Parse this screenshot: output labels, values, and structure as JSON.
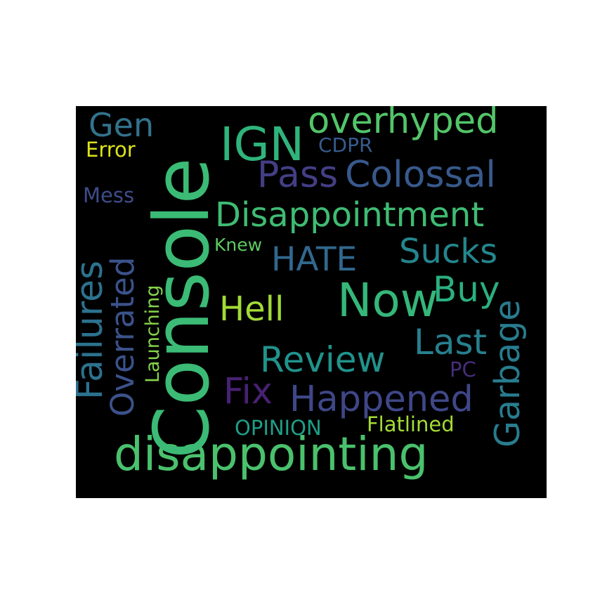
{
  "word_cloud": {
    "background": "#000000",
    "words": {
      "gen": {
        "text": "Gen",
        "color": "#33728c"
      },
      "error": {
        "text": "Error",
        "color": "#dde318"
      },
      "console": {
        "text": "Console",
        "color": "#3bbb75"
      },
      "ign": {
        "text": "IGN",
        "color": "#2fb47c"
      },
      "overhyped": {
        "text": "overhyped",
        "color": "#52c569"
      },
      "cdpr": {
        "text": "CDPR",
        "color": "#365c8d"
      },
      "pass": {
        "text": "Pass",
        "color": "#433e85"
      },
      "colossal": {
        "text": "Colossal",
        "color": "#38598c"
      },
      "mess": {
        "text": "Mess",
        "color": "#3e4c8a"
      },
      "disappointment": {
        "text": "Disappointment",
        "color": "#3fbc73"
      },
      "failures": {
        "text": "Failures",
        "color": "#2c728e"
      },
      "overrated": {
        "text": "Overrated",
        "color": "#3b528b"
      },
      "knew": {
        "text": "Knew",
        "color": "#5ec962"
      },
      "launching": {
        "text": "Launching",
        "color": "#84d44b"
      },
      "hate": {
        "text": "HATE",
        "color": "#31688e"
      },
      "sucks": {
        "text": "Sucks",
        "color": "#24868e"
      },
      "now": {
        "text": "Now",
        "color": "#35b779"
      },
      "buy": {
        "text": "Buy",
        "color": "#2ab07f"
      },
      "hell": {
        "text": "Hell",
        "color": "#a2da37"
      },
      "garbage": {
        "text": "Garbage",
        "color": "#287c8e"
      },
      "last": {
        "text": "Last",
        "color": "#277f8e"
      },
      "review": {
        "text": "Review",
        "color": "#20938c"
      },
      "pc": {
        "text": "PC",
        "color": "#472d7b"
      },
      "fix": {
        "text": "Fix",
        "color": "#482173"
      },
      "happened": {
        "text": "Happened",
        "color": "#3f4788"
      },
      "opinion": {
        "text": "OPINION",
        "color": "#1f9e89"
      },
      "flatlined": {
        "text": "Flatlined",
        "color": "#a5db36"
      },
      "disappointing": {
        "text": "disappointing",
        "color": "#4ac16d"
      }
    }
  }
}
